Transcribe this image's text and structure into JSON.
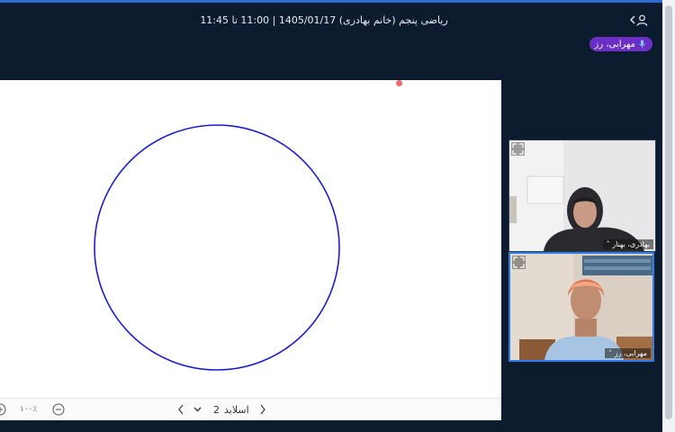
{
  "header": {
    "title": "ریاضی پنجم (خانم بهادری) 1405/01/17 | 11:00 تا 11:45",
    "speaking_user": "مهرابی، رز",
    "accent": "#2f6bd8",
    "speaker_badge_color": "#6b2fc5"
  },
  "whiteboard": {
    "shape": "circle",
    "stroke_color": "#1b1ecf",
    "laser_color": "#f06b6b",
    "toolbar": {
      "slide_label": "اسلاید",
      "slide_number": "2",
      "zoom_value": "١٠٠٪"
    }
  },
  "participants": [
    {
      "name": "بهادری، بهنار"
    },
    {
      "name": "مهرابی، رز",
      "active_speaker": true
    }
  ]
}
